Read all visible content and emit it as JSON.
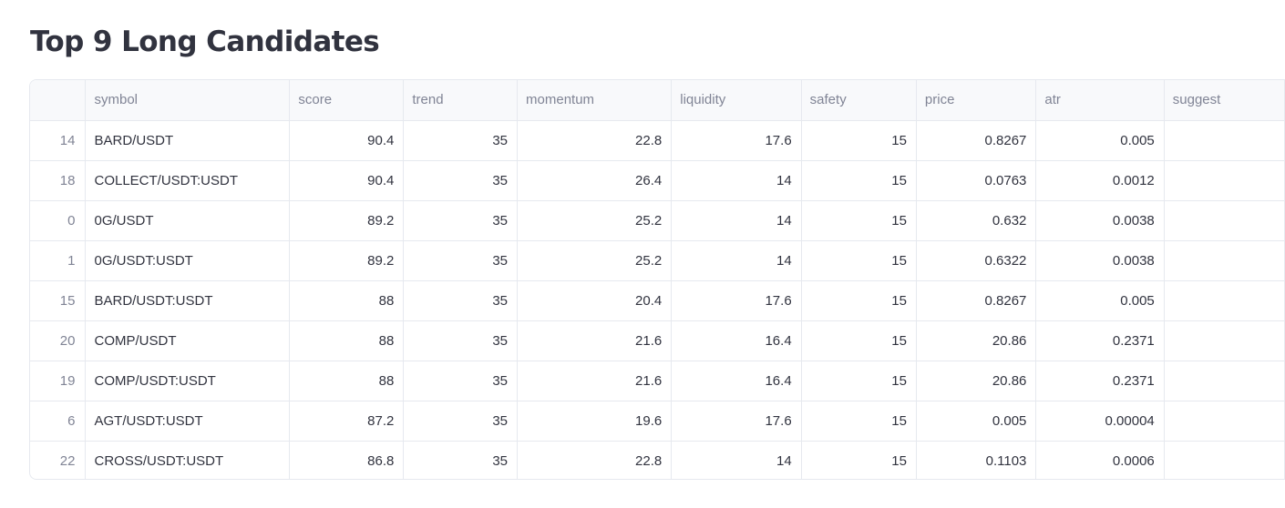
{
  "title": "Top 9 Long Candidates",
  "table": {
    "columns": [
      "",
      "symbol",
      "score",
      "trend",
      "momentum",
      "liquidity",
      "safety",
      "price",
      "atr",
      "suggest"
    ],
    "rows": [
      {
        "index": "14",
        "symbol": "BARD/USDT",
        "score": "90.4",
        "trend": "35",
        "momentum": "22.8",
        "liquidity": "17.6",
        "safety": "15",
        "price": "0.8267",
        "atr": "0.005"
      },
      {
        "index": "18",
        "symbol": "COLLECT/USDT:USDT",
        "score": "90.4",
        "trend": "35",
        "momentum": "26.4",
        "liquidity": "14",
        "safety": "15",
        "price": "0.0763",
        "atr": "0.0012"
      },
      {
        "index": "0",
        "symbol": "0G/USDT",
        "score": "89.2",
        "trend": "35",
        "momentum": "25.2",
        "liquidity": "14",
        "safety": "15",
        "price": "0.632",
        "atr": "0.0038"
      },
      {
        "index": "1",
        "symbol": "0G/USDT:USDT",
        "score": "89.2",
        "trend": "35",
        "momentum": "25.2",
        "liquidity": "14",
        "safety": "15",
        "price": "0.6322",
        "atr": "0.0038"
      },
      {
        "index": "15",
        "symbol": "BARD/USDT:USDT",
        "score": "88",
        "trend": "35",
        "momentum": "20.4",
        "liquidity": "17.6",
        "safety": "15",
        "price": "0.8267",
        "atr": "0.005"
      },
      {
        "index": "20",
        "symbol": "COMP/USDT",
        "score": "88",
        "trend": "35",
        "momentum": "21.6",
        "liquidity": "16.4",
        "safety": "15",
        "price": "20.86",
        "atr": "0.2371"
      },
      {
        "index": "19",
        "symbol": "COMP/USDT:USDT",
        "score": "88",
        "trend": "35",
        "momentum": "21.6",
        "liquidity": "16.4",
        "safety": "15",
        "price": "20.86",
        "atr": "0.2371"
      },
      {
        "index": "6",
        "symbol": "AGT/USDT:USDT",
        "score": "87.2",
        "trend": "35",
        "momentum": "19.6",
        "liquidity": "17.6",
        "safety": "15",
        "price": "0.005",
        "atr": "0.00004"
      },
      {
        "index": "22",
        "symbol": "CROSS/USDT:USDT",
        "score": "86.8",
        "trend": "35",
        "momentum": "22.8",
        "liquidity": "14",
        "safety": "15",
        "price": "0.1103",
        "atr": "0.0006"
      }
    ]
  },
  "colors": {
    "text": "#31333f",
    "header_text": "#808495",
    "header_bg": "#f8f9fb",
    "grid": "#e6e9ef"
  }
}
